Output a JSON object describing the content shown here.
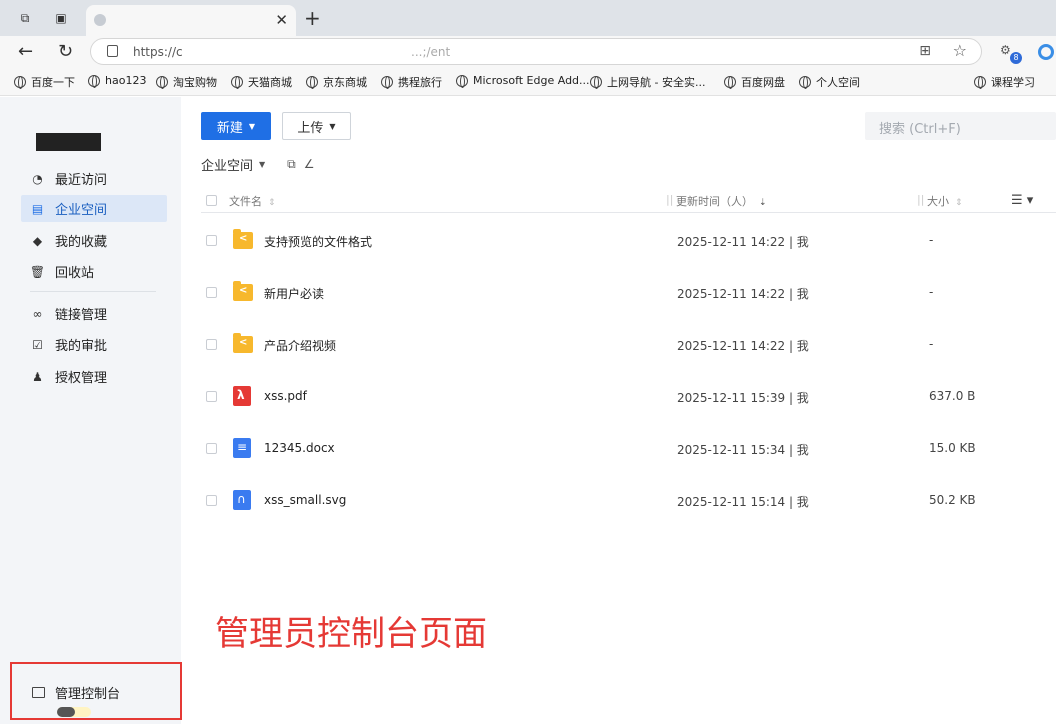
{
  "browser": {
    "tab_title": "\b ",
    "url": "https://c",
    "url_tail": "...;/ent",
    "bookmarks": [
      "百度一下",
      "hao123",
      "淘宝购物",
      "天猫商城",
      "京东商城",
      "携程旅行",
      "Microsoft Edge Add...",
      "上网导航 - 安全实...",
      "百度网盘",
      "个人空间",
      "课程学习"
    ],
    "ext_badge": "8"
  },
  "toolbar": {
    "new_label": "新建",
    "upload_label": "上传",
    "search_placeholder": "搜索  (Ctrl+F)"
  },
  "breadcrumb": {
    "current": "企业空间"
  },
  "sidebar": {
    "items": [
      {
        "label": "最近访问",
        "icon": "clock-icon"
      },
      {
        "label": "企业空间",
        "icon": "building-icon",
        "active": true
      },
      {
        "label": "我的收藏",
        "icon": "box-icon"
      },
      {
        "label": "回收站",
        "icon": "trash-icon"
      },
      {
        "label": "链接管理",
        "icon": "link-icon"
      },
      {
        "label": "我的审批",
        "icon": "check-icon"
      },
      {
        "label": "授权管理",
        "icon": "user-key-icon"
      }
    ],
    "admin_label": "管理控制台"
  },
  "table": {
    "headers": {
      "name": "文件名",
      "time": "更新时间（人）",
      "size": "大小"
    },
    "rows": [
      {
        "name": "支持预览的文件格式",
        "time": "2025-12-11 14:22 | 我",
        "size": "-",
        "type": "folder"
      },
      {
        "name": "新用户必读",
        "time": "2025-12-11 14:22 | 我",
        "size": "-",
        "type": "folder"
      },
      {
        "name": "产品介绍视频",
        "time": "2025-12-11 14:22 | 我",
        "size": "-",
        "type": "folder"
      },
      {
        "name": "xss.pdf",
        "time": "2025-12-11 15:39 | 我",
        "size": "637.0 B",
        "type": "pdf"
      },
      {
        "name": "12345.docx",
        "time": "2025-12-11 15:34 | 我",
        "size": "15.0 KB",
        "type": "doc"
      },
      {
        "name": "xss_small.svg",
        "time": "2025-12-11 15:14 | 我",
        "size": "50.2 KB",
        "type": "svg"
      }
    ]
  },
  "annotation": "管理员控制台页面"
}
